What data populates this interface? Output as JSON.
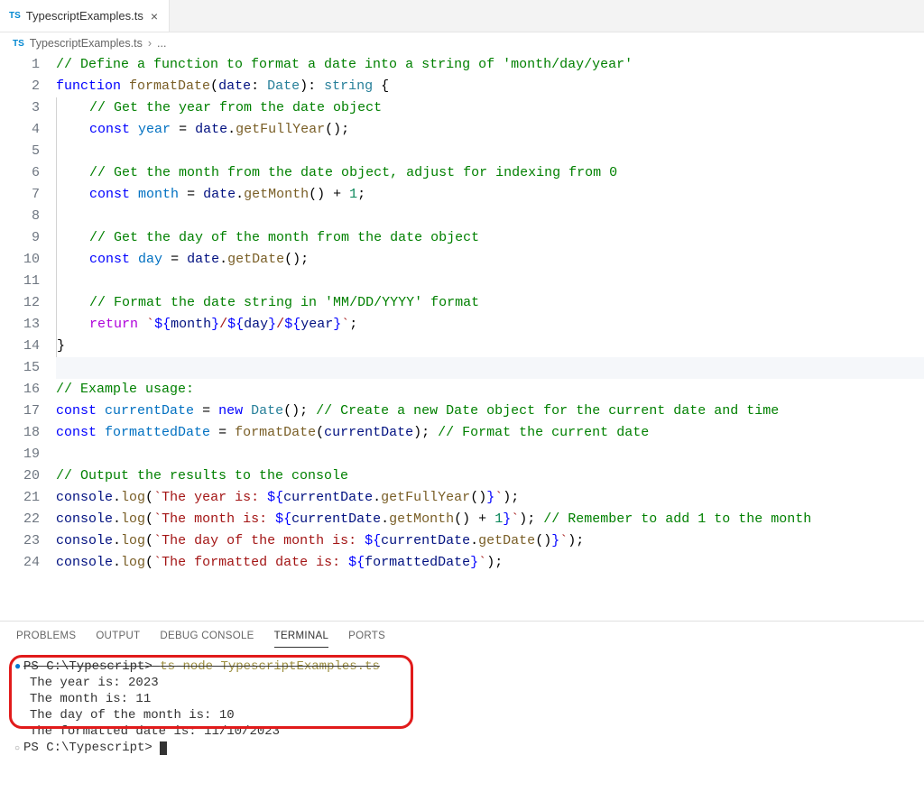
{
  "tab": {
    "icon": "TS",
    "filename": "TypescriptExamples.ts"
  },
  "breadcrumb": {
    "icon": "TS",
    "filename": "TypescriptExamples.ts",
    "sep": "›",
    "rest": "..."
  },
  "code": {
    "lines": [
      [
        [
          "comment",
          "// Define a function to format a date into a string of 'month/day/year'"
        ]
      ],
      [
        [
          "keyword",
          "function"
        ],
        [
          "punc",
          " "
        ],
        [
          "func",
          "formatDate"
        ],
        [
          "punc",
          "("
        ],
        [
          "var",
          "date"
        ],
        [
          "punc",
          ": "
        ],
        [
          "type",
          "Date"
        ],
        [
          "punc",
          "): "
        ],
        [
          "type",
          "string"
        ],
        [
          "punc",
          " {"
        ]
      ],
      [
        [
          "pad",
          "    "
        ],
        [
          "comment",
          "// Get the year from the date object"
        ]
      ],
      [
        [
          "pad",
          "    "
        ],
        [
          "keyword",
          "const"
        ],
        [
          "punc",
          " "
        ],
        [
          "const",
          "year"
        ],
        [
          "punc",
          " = "
        ],
        [
          "var",
          "date"
        ],
        [
          "punc",
          "."
        ],
        [
          "func",
          "getFullYear"
        ],
        [
          "punc",
          "();"
        ]
      ],
      [
        [
          "pad",
          "    "
        ]
      ],
      [
        [
          "pad",
          "    "
        ],
        [
          "comment",
          "// Get the month from the date object, adjust for indexing from 0"
        ]
      ],
      [
        [
          "pad",
          "    "
        ],
        [
          "keyword",
          "const"
        ],
        [
          "punc",
          " "
        ],
        [
          "const",
          "month"
        ],
        [
          "punc",
          " = "
        ],
        [
          "var",
          "date"
        ],
        [
          "punc",
          "."
        ],
        [
          "func",
          "getMonth"
        ],
        [
          "punc",
          "() + "
        ],
        [
          "num",
          "1"
        ],
        [
          "punc",
          ";"
        ]
      ],
      [
        [
          "pad",
          "    "
        ]
      ],
      [
        [
          "pad",
          "    "
        ],
        [
          "comment",
          "// Get the day of the month from the date object"
        ]
      ],
      [
        [
          "pad",
          "    "
        ],
        [
          "keyword",
          "const"
        ],
        [
          "punc",
          " "
        ],
        [
          "const",
          "day"
        ],
        [
          "punc",
          " = "
        ],
        [
          "var",
          "date"
        ],
        [
          "punc",
          "."
        ],
        [
          "func",
          "getDate"
        ],
        [
          "punc",
          "();"
        ]
      ],
      [
        [
          "pad",
          "    "
        ]
      ],
      [
        [
          "pad",
          "    "
        ],
        [
          "comment",
          "// Format the date string in 'MM/DD/YYYY' format"
        ]
      ],
      [
        [
          "pad",
          "    "
        ],
        [
          "control",
          "return"
        ],
        [
          "punc",
          " "
        ],
        [
          "string",
          "`"
        ],
        [
          "tmpl",
          "${"
        ],
        [
          "var",
          "month"
        ],
        [
          "tmpl",
          "}"
        ],
        [
          "string",
          "/"
        ],
        [
          "tmpl",
          "${"
        ],
        [
          "var",
          "day"
        ],
        [
          "tmpl",
          "}"
        ],
        [
          "string",
          "/"
        ],
        [
          "tmpl",
          "${"
        ],
        [
          "var",
          "year"
        ],
        [
          "tmpl",
          "}"
        ],
        [
          "string",
          "`"
        ],
        [
          "punc",
          ";"
        ]
      ],
      [
        [
          "punc",
          "}"
        ]
      ],
      [],
      [
        [
          "comment",
          "// Example usage:"
        ]
      ],
      [
        [
          "keyword",
          "const"
        ],
        [
          "punc",
          " "
        ],
        [
          "const",
          "currentDate"
        ],
        [
          "punc",
          " = "
        ],
        [
          "keyword",
          "new"
        ],
        [
          "punc",
          " "
        ],
        [
          "type",
          "Date"
        ],
        [
          "punc",
          "(); "
        ],
        [
          "comment",
          "// Create a new Date object for the current date and time"
        ]
      ],
      [
        [
          "keyword",
          "const"
        ],
        [
          "punc",
          " "
        ],
        [
          "const",
          "formattedDate"
        ],
        [
          "punc",
          " = "
        ],
        [
          "func",
          "formatDate"
        ],
        [
          "punc",
          "("
        ],
        [
          "var",
          "currentDate"
        ],
        [
          "punc",
          "); "
        ],
        [
          "comment",
          "// Format the current date"
        ]
      ],
      [],
      [
        [
          "comment",
          "// Output the results to the console"
        ]
      ],
      [
        [
          "var",
          "console"
        ],
        [
          "punc",
          "."
        ],
        [
          "func",
          "log"
        ],
        [
          "punc",
          "("
        ],
        [
          "string",
          "`The year is: "
        ],
        [
          "tmpl",
          "${"
        ],
        [
          "var",
          "currentDate"
        ],
        [
          "punc",
          "."
        ],
        [
          "func",
          "getFullYear"
        ],
        [
          "punc",
          "()"
        ],
        [
          "tmpl",
          "}"
        ],
        [
          "string",
          "`"
        ],
        [
          "punc",
          ");"
        ]
      ],
      [
        [
          "var",
          "console"
        ],
        [
          "punc",
          "."
        ],
        [
          "func",
          "log"
        ],
        [
          "punc",
          "("
        ],
        [
          "string",
          "`The month is: "
        ],
        [
          "tmpl",
          "${"
        ],
        [
          "var",
          "currentDate"
        ],
        [
          "punc",
          "."
        ],
        [
          "func",
          "getMonth"
        ],
        [
          "punc",
          "() + "
        ],
        [
          "num",
          "1"
        ],
        [
          "tmpl",
          "}"
        ],
        [
          "string",
          "`"
        ],
        [
          "punc",
          "); "
        ],
        [
          "comment",
          "// Remember to add 1 to the month"
        ]
      ],
      [
        [
          "var",
          "console"
        ],
        [
          "punc",
          "."
        ],
        [
          "func",
          "log"
        ],
        [
          "punc",
          "("
        ],
        [
          "string",
          "`The day of the month is: "
        ],
        [
          "tmpl",
          "${"
        ],
        [
          "var",
          "currentDate"
        ],
        [
          "punc",
          "."
        ],
        [
          "func",
          "getDate"
        ],
        [
          "punc",
          "()"
        ],
        [
          "tmpl",
          "}"
        ],
        [
          "string",
          "`"
        ],
        [
          "punc",
          ");"
        ]
      ],
      [
        [
          "var",
          "console"
        ],
        [
          "punc",
          "."
        ],
        [
          "func",
          "log"
        ],
        [
          "punc",
          "("
        ],
        [
          "string",
          "`The formatted date is: "
        ],
        [
          "tmpl",
          "${"
        ],
        [
          "var",
          "formattedDate"
        ],
        [
          "tmpl",
          "}"
        ],
        [
          "string",
          "`"
        ],
        [
          "punc",
          ");"
        ]
      ]
    ],
    "highlighted_line_index": 14
  },
  "panel": {
    "tabs": [
      "PROBLEMS",
      "OUTPUT",
      "DEBUG CONSOLE",
      "TERMINAL",
      "PORTS"
    ],
    "active_tab_index": 3
  },
  "terminal": {
    "prompt1_prefix": "PS C:\\Typescript> ",
    "prompt1_cmd": "ts-node TypescriptExamples.ts",
    "out1": "The year is: 2023",
    "out2": "The month is: 11",
    "out3": "The day of the month is: 10",
    "out4": "The formatted date is: 11/10/2023",
    "prompt2": "PS C:\\Typescript> "
  }
}
